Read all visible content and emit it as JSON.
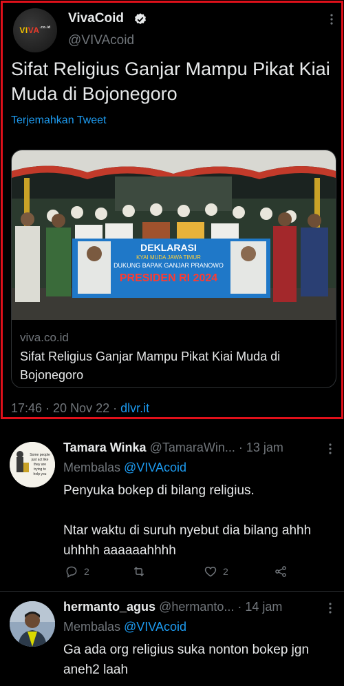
{
  "main_tweet": {
    "author_name": "VivaCoid",
    "author_handle": "@VIVAcoid",
    "logo_text": {
      "a": "VI",
      "b": "VA",
      "c": ".co.id"
    },
    "text": "Sifat Religius Ganjar Mampu Pikat Kiai Muda di Bojonegoro",
    "translate_label": "Terjemahkan Tweet",
    "card": {
      "banner_line1": "DEKLARASI",
      "banner_line2": "KYAI MUDA JAWA TIMUR",
      "banner_line3": "DUKUNG BAPAK GANJAR PRANOWO",
      "banner_line4": "PRESIDEN RI 2024",
      "domain": "viva.co.id",
      "title": "Sifat Religius Ganjar Mampu Pikat Kiai Muda di Bojonegoro"
    },
    "time": "17:46 · 20 Nov 22 · ",
    "source": "dlvr.it",
    "colors": {
      "highlight_border": "#e0101a",
      "accent": "#1d9bf0",
      "muted": "#71767b"
    }
  },
  "replies": [
    {
      "name": "Tamara Winka",
      "handle": "@TamaraWin...",
      "time": "· 13 jam",
      "replying_prefix": "Membalas ",
      "replying_mention": "@VIVAcoid",
      "text_lines": [
        "Penyuka bokep di bilang religius.",
        "",
        "Ntar waktu di suruh nyebut dia bilang ahhh uhhhh aaaaaahhhh"
      ],
      "avatar_caption": [
        "Some people",
        "just act like",
        "they are",
        "trying to",
        "help you"
      ],
      "reply_count": "2",
      "retweet_count": "",
      "like_count": "2"
    },
    {
      "name": "hermanto_agus",
      "handle": "@hermanto...",
      "time": "· 14 jam",
      "replying_prefix": "Membalas ",
      "replying_mention": "@VIVAcoid",
      "text_lines": [
        "Ga ada org religius suka nonton bokep jgn aneh2 laah"
      ]
    }
  ]
}
